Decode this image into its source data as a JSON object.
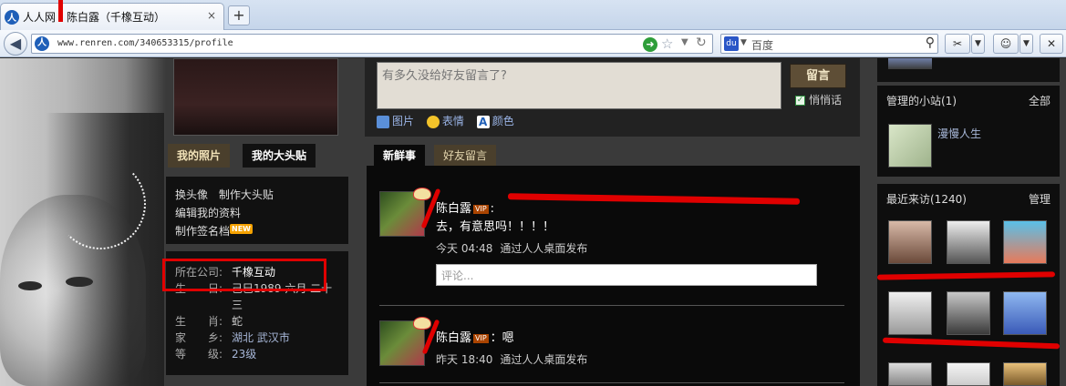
{
  "browser": {
    "tab_title": "人人网 - 陈白露（千橡互动）",
    "url": "www.renren.com/340653315/profile",
    "search_engine_placeholder": "百度",
    "new_tab": "+",
    "close_tab": "×"
  },
  "left": {
    "photo_tabs": [
      "我的照片",
      "我的大头贴"
    ],
    "links": {
      "change_avatar": "换头像",
      "make_sticker": "制作大头贴",
      "edit_profile": "编辑我的资料",
      "make_signature": "制作签名档",
      "new_badge": "NEW"
    },
    "info": [
      {
        "key": "所在公司:",
        "value": "千橡互动"
      },
      {
        "key": "生　　日:",
        "value": "己巳1989 六月 二十"
      },
      {
        "key": "",
        "value": "三"
      },
      {
        "key": "生　　肖:",
        "value": "蛇"
      },
      {
        "key": "家　　乡:",
        "value": "湖北 武汉市"
      },
      {
        "key": "等　　级:",
        "value": "23级"
      }
    ]
  },
  "center": {
    "message_placeholder": "有多久没给好友留言了?",
    "message_button": "留言",
    "whisper_label": "悄悄话",
    "tools": [
      "图片",
      "表情",
      "颜色"
    ],
    "feed_tabs": [
      "新鲜事",
      "好友留言"
    ],
    "posts": [
      {
        "author": "陈白露",
        "vip": "VIP",
        "line2": "去，有意思吗！！！！",
        "time": "今天 04:48",
        "via": "通过人人桌面发布",
        "comment_placeholder": "评论..."
      },
      {
        "author": "陈白露",
        "vip": "VIP",
        "text": "：嗯",
        "time": "昨天 18:40",
        "via": "通过人人桌面发布"
      }
    ]
  },
  "right": {
    "site_panel": {
      "title": "管理的小站(1)",
      "action": "全部",
      "site_name": "漫慢人生"
    },
    "visitors_panel": {
      "title": "最近来访(1240)",
      "action": "管理"
    }
  },
  "colors": {
    "annotation_red": "#e00000",
    "page_bg": "#3a3a3a",
    "link_blue": "#a7b7d8"
  }
}
